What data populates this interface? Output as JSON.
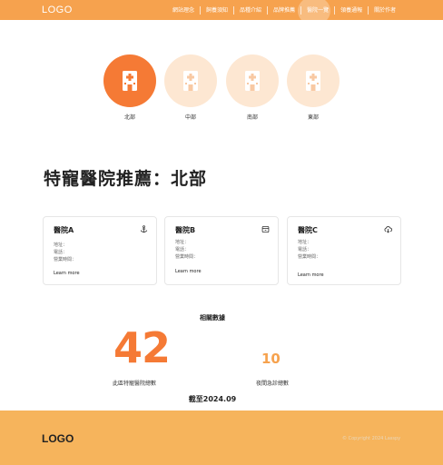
{
  "header": {
    "logo": "LOGO",
    "nav": [
      {
        "label": "網站理念"
      },
      {
        "label": "飼養須知"
      },
      {
        "label": "品種介紹"
      },
      {
        "label": "品牌推薦"
      },
      {
        "label": "醫院一覽"
      },
      {
        "label": "領養通報"
      },
      {
        "label": "關於作者"
      }
    ],
    "active_nav": "醫院一覽"
  },
  "regions": [
    {
      "label": "北部",
      "active": true
    },
    {
      "label": "中部",
      "active": false
    },
    {
      "label": "南部",
      "active": false
    },
    {
      "label": "東部",
      "active": false
    }
  ],
  "section_title": "特寵醫院推薦：北部",
  "hospitals": [
    {
      "name": "醫院A",
      "icon": "anchor-icon",
      "address": "地址：",
      "phone": "電話：",
      "hours": "營業時間：",
      "link": "Learn more"
    },
    {
      "name": "醫院B",
      "icon": "box-icon",
      "address": "地址：",
      "phone": "電話：",
      "hours": "營業時間：",
      "link": "Learn more"
    },
    {
      "name": "醫院C",
      "icon": "cloud-download-icon",
      "address": "地址：",
      "phone": "電話：",
      "hours": "營業時間：",
      "link": "Learn more"
    }
  ],
  "stats": {
    "title": "相關數據",
    "total_value": "42",
    "total_label": "此區特寵醫院總數",
    "emergency_value": "10",
    "emergency_label": "夜間急診總數",
    "as_of": "截至2024.09"
  },
  "footer": {
    "logo": "LOGO",
    "copyright": "© Copyright 2024 Lasspy"
  },
  "colors": {
    "header_bg": "#f6a24e",
    "accent": "#f57a35",
    "circle_inactive": "#fde7d2",
    "footer_bg": "#f6b45c"
  }
}
